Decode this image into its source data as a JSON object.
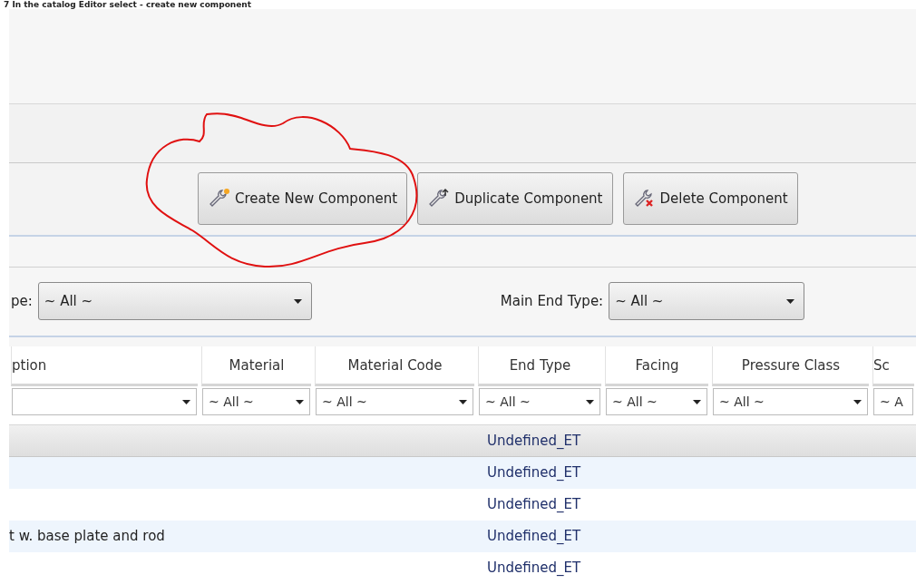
{
  "caption": "7 In the catalog Editor select - create new component",
  "toolbar": {
    "buttons": [
      {
        "kind": "create",
        "label": "Create New Component"
      },
      {
        "kind": "duplicate",
        "label": "Duplicate Component"
      },
      {
        "kind": "delete",
        "label": "Delete Component"
      }
    ]
  },
  "filters": [
    {
      "label": "pe:",
      "value": "~ All ~"
    },
    {
      "label": "Main End Type:",
      "value": "~ All ~"
    }
  ],
  "table": {
    "columns": [
      {
        "label": "ption"
      },
      {
        "label": "Material",
        "filter": "~ All ~"
      },
      {
        "label": "Material Code",
        "filter": "~ All ~"
      },
      {
        "label": "End Type",
        "filter": "~ All ~"
      },
      {
        "label": "Facing",
        "filter": "~ All ~"
      },
      {
        "label": "Pressure Class",
        "filter": "~ All ~"
      },
      {
        "label": "Sc",
        "filter": "~ A"
      }
    ],
    "rows": [
      {
        "selected": true,
        "cells": [
          "",
          "",
          "",
          "Undefined_ET",
          "",
          "",
          ""
        ]
      },
      {
        "selected": false,
        "cells": [
          "",
          "",
          "",
          "Undefined_ET",
          "",
          "",
          ""
        ]
      },
      {
        "selected": false,
        "cells": [
          "",
          "",
          "",
          "Undefined_ET",
          "",
          "",
          ""
        ]
      },
      {
        "selected": false,
        "cells": [
          "t w. base plate and rod",
          "",
          "",
          "Undefined_ET",
          "",
          "",
          ""
        ]
      },
      {
        "selected": false,
        "cells": [
          "",
          "",
          "",
          "Undefined_ET",
          "",
          "",
          ""
        ]
      }
    ]
  }
}
